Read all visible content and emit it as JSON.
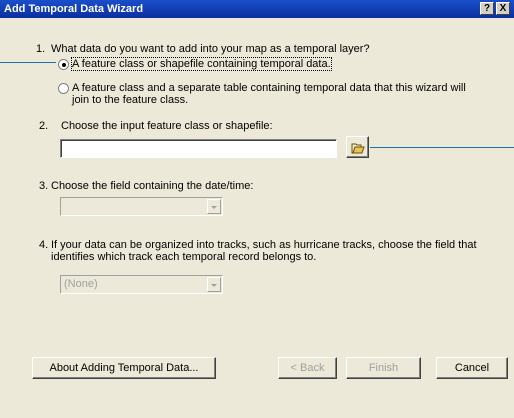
{
  "window": {
    "title": "Add Temporal Data Wizard",
    "help_btn": "?",
    "close_btn": "X"
  },
  "step1": {
    "number": "1.",
    "question": "What data do you want to add into your map as a temporal layer?",
    "option1": "A feature class or shapefile containing temporal data.",
    "option2_line1": "A feature class and a separate table containing temporal data that this wizard will",
    "option2_line2": "join to the feature class.",
    "selected": "option1"
  },
  "step2": {
    "number": "2.",
    "label": "Choose the input feature class or shapefile:",
    "value": "",
    "browse_icon": "open-folder-icon"
  },
  "step3": {
    "number": "3.",
    "label": "Choose the field containing the date/time:",
    "value": ""
  },
  "step4": {
    "number": "4.",
    "line1": "If your data can be organized into tracks, such as hurricane tracks, choose the field that",
    "line2": "identifies which track each temporal record belongs to.",
    "value": "(None)"
  },
  "buttons": {
    "about": "About Adding Temporal Data...",
    "back": "< Back",
    "finish": "Finish",
    "cancel": "Cancel"
  },
  "colors": {
    "callout": "#1f6fa8",
    "titlebar": "#0a2f9f",
    "dialog_bg": "#ece9d8"
  }
}
